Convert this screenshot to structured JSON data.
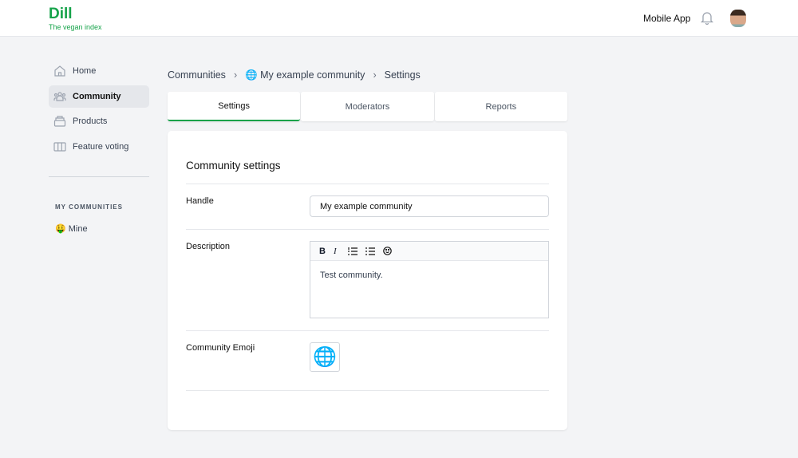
{
  "header": {
    "logo": "Dill",
    "tagline": "The vegan index",
    "mobile_app": "Mobile App"
  },
  "sidebar": {
    "items": [
      {
        "label": "Home"
      },
      {
        "label": "Community"
      },
      {
        "label": "Products"
      },
      {
        "label": "Feature voting"
      }
    ],
    "section_title": "MY COMMUNITIES",
    "communities": [
      {
        "emoji": "🤑",
        "label": "Mine"
      }
    ]
  },
  "breadcrumb": {
    "root": "Communities",
    "community": "🌐 My example community",
    "current": "Settings"
  },
  "tabs": [
    {
      "label": "Settings"
    },
    {
      "label": "Moderators"
    },
    {
      "label": "Reports"
    }
  ],
  "form": {
    "title": "Community settings",
    "handle_label": "Handle",
    "handle_value": "My example community",
    "description_label": "Description",
    "description_value": "Test community.",
    "emoji_label": "Community Emoji",
    "emoji_value": "🌐",
    "toolbar": {
      "bold": "B",
      "italic": "I"
    }
  },
  "colors": {
    "brand": "#16a34a"
  }
}
